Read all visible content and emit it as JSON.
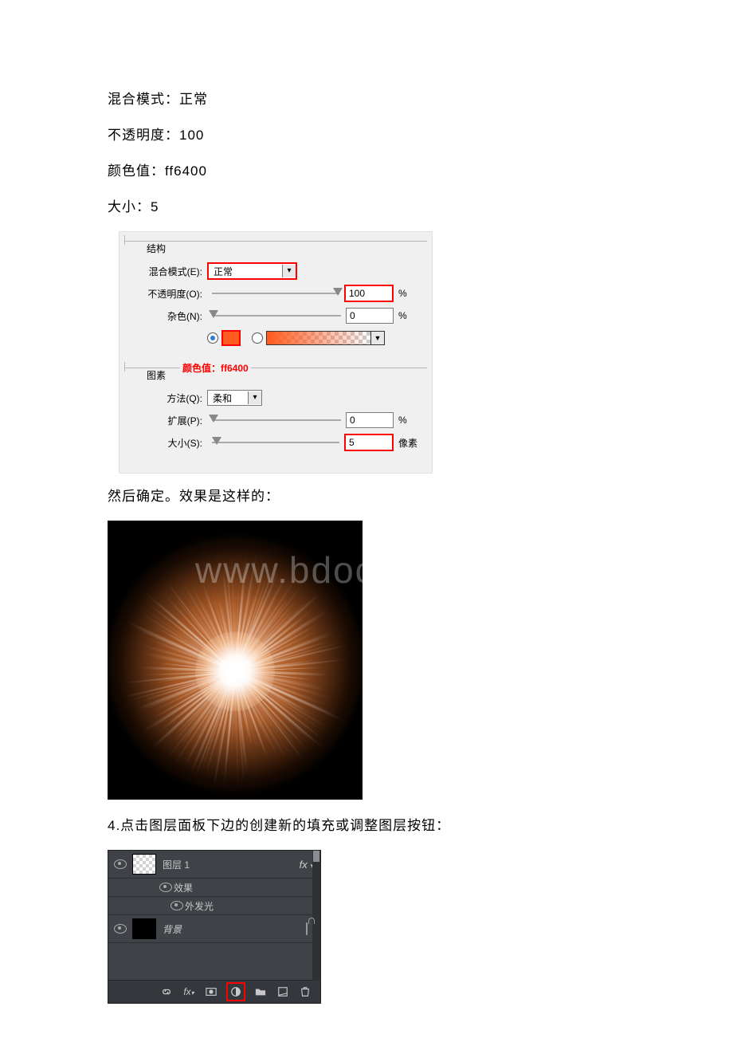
{
  "doc": {
    "line1": "混合模式：正常",
    "line2": "不透明度：100",
    "line3": "颜色值：ff6400",
    "line4": "大小：5",
    "after_panel": "然后确定。效果是这样的：",
    "step4": "4.点击图层面板下边的创建新的填充或调整图层按钮："
  },
  "structure": {
    "legend": "结构",
    "blend_label": "混合模式(E):",
    "blend_value": "正常",
    "opacity_label": "不透明度(O):",
    "opacity_value": "100",
    "opacity_unit": "%",
    "noise_label": "杂色(N):",
    "noise_value": "0",
    "noise_unit": "%",
    "swatch_color": "#ff5a1f",
    "color_annot": "颜色值：ff6400"
  },
  "elements": {
    "legend": "图素",
    "method_label": "方法(Q):",
    "method_value": "柔和",
    "spread_label": "扩展(P):",
    "spread_value": "0",
    "spread_unit": "%",
    "size_label": "大小(S):",
    "size_value": "5",
    "size_unit": "像素"
  },
  "watermark": "www.bdocx.com",
  "layers": {
    "layer1_name": "图层 1",
    "effects_name": "效果",
    "outer_glow_name": "外发光",
    "bg_name": "背景",
    "fx": "fx"
  }
}
